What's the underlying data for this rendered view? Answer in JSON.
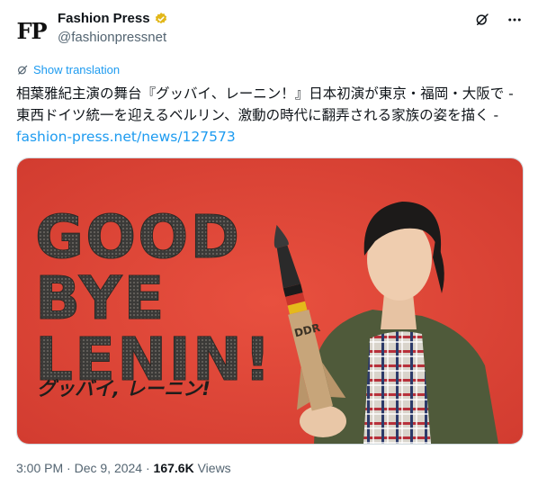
{
  "author": {
    "avatar_text": "FP",
    "name": "Fashion Press",
    "handle": "@fashionpressnet"
  },
  "actions": {
    "grok_icon": "grok-icon",
    "more_icon": "more-icon"
  },
  "tweet": {
    "show_translation": "Show translation",
    "text": "相葉雅紀主演の舞台『グッバイ、レーニン！』日本初演が東京・福岡・大阪で - 東西ドイツ統一を迎えるベルリン、激動の時代に翻弄される家族の姿を描く - ",
    "link": "fashion-press.net/news/127573"
  },
  "media": {
    "title_line1": "GOOD",
    "title_line2": "BYE",
    "title_line3": "LENIN!",
    "subtitle_jp": "グッバイ, レーニン!",
    "rocket_label": "DDR",
    "background_color": "#e2463a"
  },
  "meta": {
    "time": "3:00 PM",
    "separator1": " · ",
    "date": "Dec 9, 2024",
    "separator2": " · ",
    "views_count": "167.6K",
    "views_label": " Views"
  }
}
